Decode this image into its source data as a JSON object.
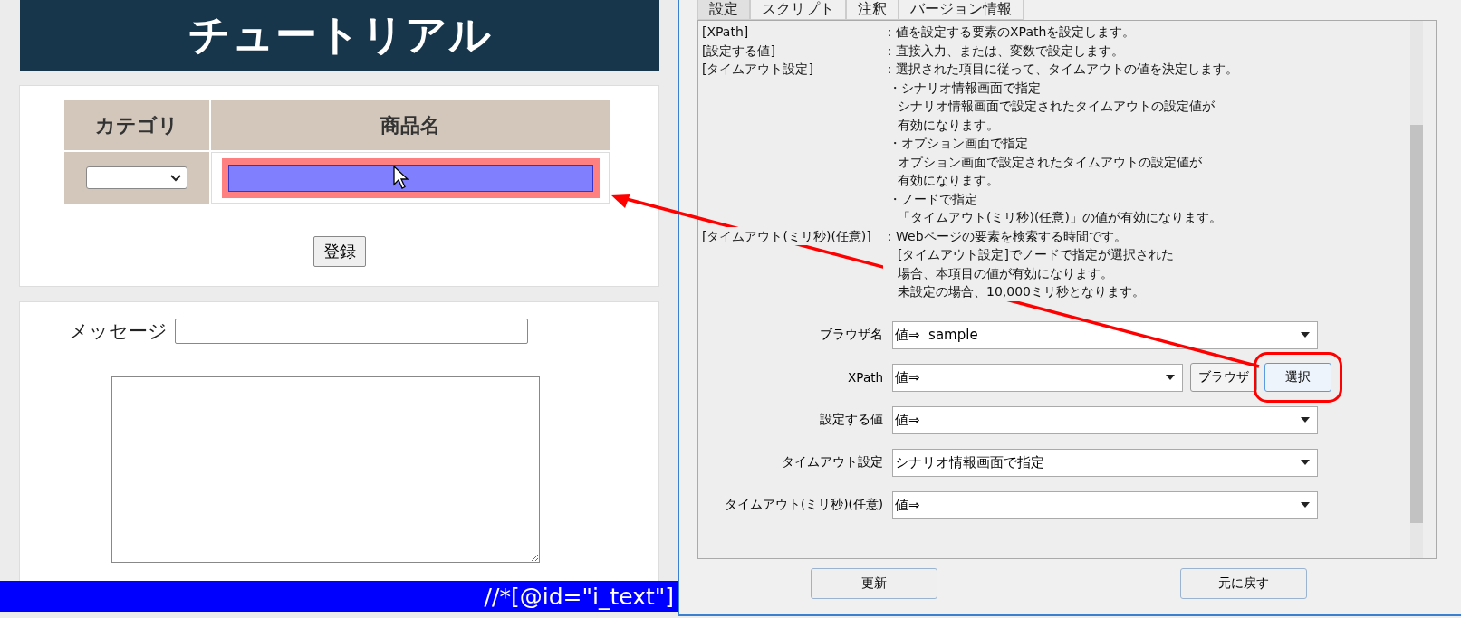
{
  "web_page": {
    "title": "チュートリアル",
    "table": {
      "columns": [
        "カテゴリ",
        "商品名"
      ],
      "product_field": {
        "highlighted": true
      }
    },
    "register_button": "登録",
    "message_label": "メッセージ",
    "xpath_bar": "//*[@id=\"i_text\"]"
  },
  "dialog": {
    "tabs": [
      {
        "label": "設定",
        "selected": true
      },
      {
        "label": "スクリプト",
        "selected": false
      },
      {
        "label": "注釈",
        "selected": false
      },
      {
        "label": "バージョン情報",
        "selected": false
      }
    ],
    "help": [
      {
        "label": "[XPath]",
        "lines": [
          {
            "kind": "desc",
            "text": "：値を設定する要素のXPathを設定します。"
          }
        ]
      },
      {
        "label": "[設定する値]",
        "lines": [
          {
            "kind": "desc",
            "text": "：直接入力、または、変数で設定します。"
          }
        ]
      },
      {
        "label": "[タイムアウト設定]",
        "lines": [
          {
            "kind": "desc",
            "text": "：選択された項目に従って、タイムアウトの値を決定します。"
          },
          {
            "kind": "bullet",
            "text": "・シナリオ情報画面で指定"
          },
          {
            "kind": "sub",
            "text": "シナリオ情報画面で設定されたタイムアウトの設定値が"
          },
          {
            "kind": "sub",
            "text": "有効になります。"
          },
          {
            "kind": "bullet",
            "text": "・オプション画面で指定"
          },
          {
            "kind": "sub",
            "text": "オプション画面で設定されたタイムアウトの設定値が"
          },
          {
            "kind": "sub",
            "text": "有効になります。"
          },
          {
            "kind": "bullet",
            "text": "・ノードで指定"
          },
          {
            "kind": "sub",
            "text": "「タイムアウト(ミリ秒)(任意)」の値が有効になります。"
          }
        ]
      },
      {
        "label": "[タイムアウト(ミリ秒)(任意)]",
        "lines": [
          {
            "kind": "desc",
            "text": "：Webページの要素を検索する時間です。"
          },
          {
            "kind": "sub",
            "text": "[タイムアウト設定]でノードで指定が選択された"
          },
          {
            "kind": "sub",
            "text": "場合、本項目の値が有効になります。"
          },
          {
            "kind": "sub",
            "text": "未設定の場合、10,000ミリ秒となります。"
          }
        ]
      }
    ],
    "fields": [
      {
        "label": "ブラウザ名",
        "value": "値⇒  sample"
      },
      {
        "label": "XPath",
        "value": "値⇒",
        "buttons": [
          {
            "label": "ブラウザ",
            "highlighted": false
          },
          {
            "label": "選択",
            "highlighted": true
          }
        ]
      },
      {
        "label": "設定する値",
        "value": "値⇒"
      },
      {
        "label": "タイムアウト設定",
        "value": "シナリオ情報画面で指定"
      },
      {
        "label": "タイムアウト(ミリ秒)(任意)",
        "value": "値⇒"
      }
    ],
    "footer_buttons": [
      "更新",
      "元に戻す"
    ]
  }
}
